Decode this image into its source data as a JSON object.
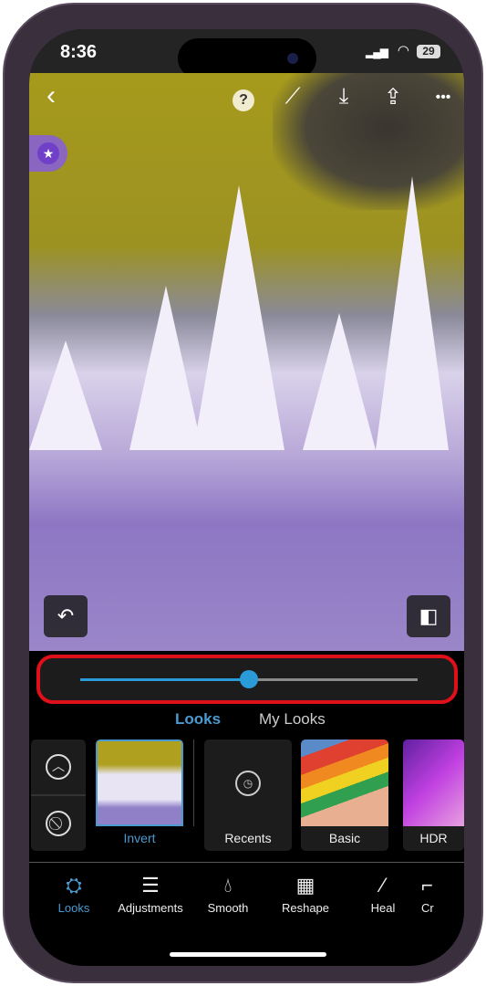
{
  "status": {
    "time": "8:36",
    "battery": "29"
  },
  "toolbar": {
    "help": "?",
    "more": "•••"
  },
  "slider": {
    "value_fraction": 0.5,
    "accent": "#2a9ad8",
    "highlight": "#e0101a"
  },
  "tabs": [
    {
      "label": "Looks",
      "active": true
    },
    {
      "label": "My Looks",
      "active": false
    }
  ],
  "looks": [
    {
      "label": "Invert",
      "selected": true
    },
    {
      "label": "Recents"
    },
    {
      "label": "Basic"
    },
    {
      "label": "HDR"
    }
  ],
  "tools": [
    {
      "label": "Looks",
      "active": true
    },
    {
      "label": "Adjustments"
    },
    {
      "label": "Smooth"
    },
    {
      "label": "Reshape"
    },
    {
      "label": "Heal"
    },
    {
      "label": "Cr"
    }
  ]
}
